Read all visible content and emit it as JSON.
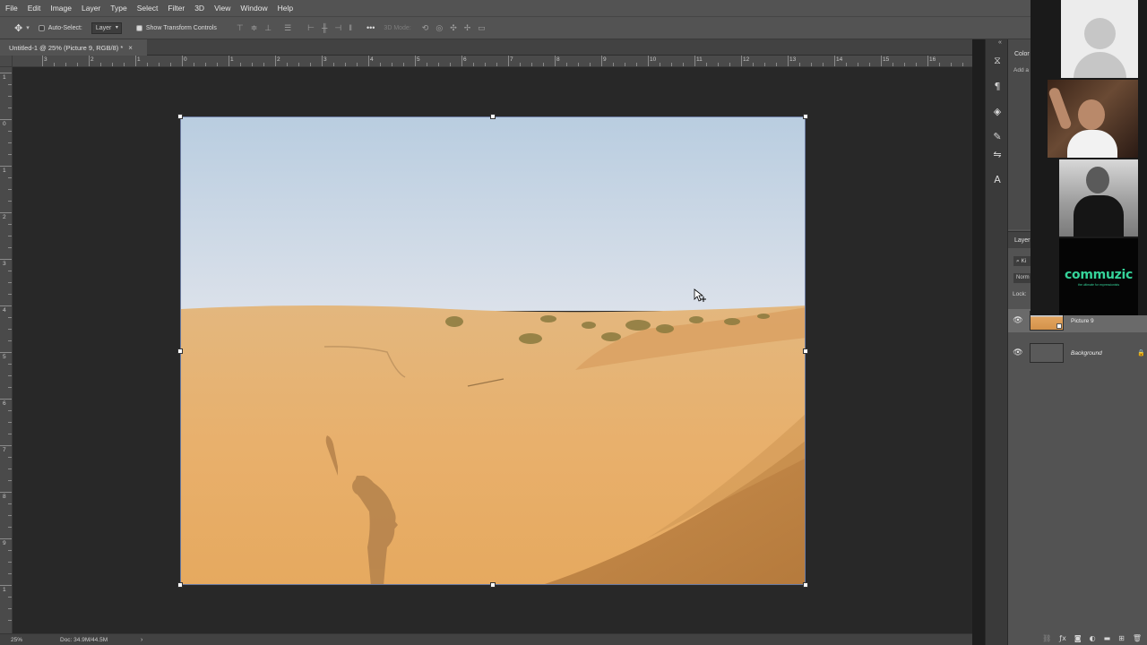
{
  "menubar": {
    "items": [
      "File",
      "Edit",
      "Image",
      "Layer",
      "Type",
      "Select",
      "Filter",
      "3D",
      "View",
      "Window",
      "Help"
    ]
  },
  "options": {
    "tool_icon": "move-tool-icon",
    "auto_select_label": "Auto-Select:",
    "auto_select_checked": false,
    "auto_select_target": "Layer",
    "show_transform_label": "Show Transform Controls",
    "show_transform_checked": true,
    "mode_3d_label": "3D Mode:"
  },
  "document": {
    "tab_title": "Untitled-1 @ 25% (Picture 9, RGB/8) *",
    "close_glyph": "×"
  },
  "rulers": {
    "top_labels": [
      "3",
      "2",
      "1",
      "0",
      "1",
      "2",
      "3",
      "4",
      "5",
      "6",
      "7",
      "8",
      "9",
      "10",
      "11",
      "12",
      "13",
      "14",
      "15",
      "16"
    ],
    "left_labels": [
      "1",
      "0",
      "1",
      "2",
      "3",
      "4",
      "5",
      "6",
      "7",
      "8",
      "9",
      "1"
    ]
  },
  "status": {
    "zoom": "25%",
    "doc_size": "Doc: 34.9M/44.5M",
    "arrow": "›"
  },
  "side_icons": [
    "history-icon",
    "paragraph-icon",
    "channels-icon",
    "brush-icon",
    "adjustments-icon",
    "character-icon"
  ],
  "panels": {
    "color_tab": "Color",
    "add_label": "Add a",
    "layers_tab": "Layer",
    "filter_text": "Ki",
    "blend_mode": "Norm",
    "lock_label": "Lock:",
    "layers": [
      {
        "name": "Picture 9",
        "visible": true,
        "selected": true,
        "smart_object": true
      },
      {
        "name": "Background",
        "visible": true,
        "selected": false,
        "locked": true
      }
    ],
    "footer_icons": [
      "link-icon",
      "fx-icon",
      "mask-icon",
      "adjustment-layer-icon",
      "group-icon",
      "new-layer-icon",
      "trash-icon"
    ]
  },
  "video_call": {
    "logo_text": "commuzic",
    "logo_tagline": "the ultimate for expressionists"
  },
  "colors": {
    "ui_dark": "#282828",
    "panel": "#535353",
    "selection_border": "#6a7aa0",
    "logo_green": "#35d49a"
  }
}
